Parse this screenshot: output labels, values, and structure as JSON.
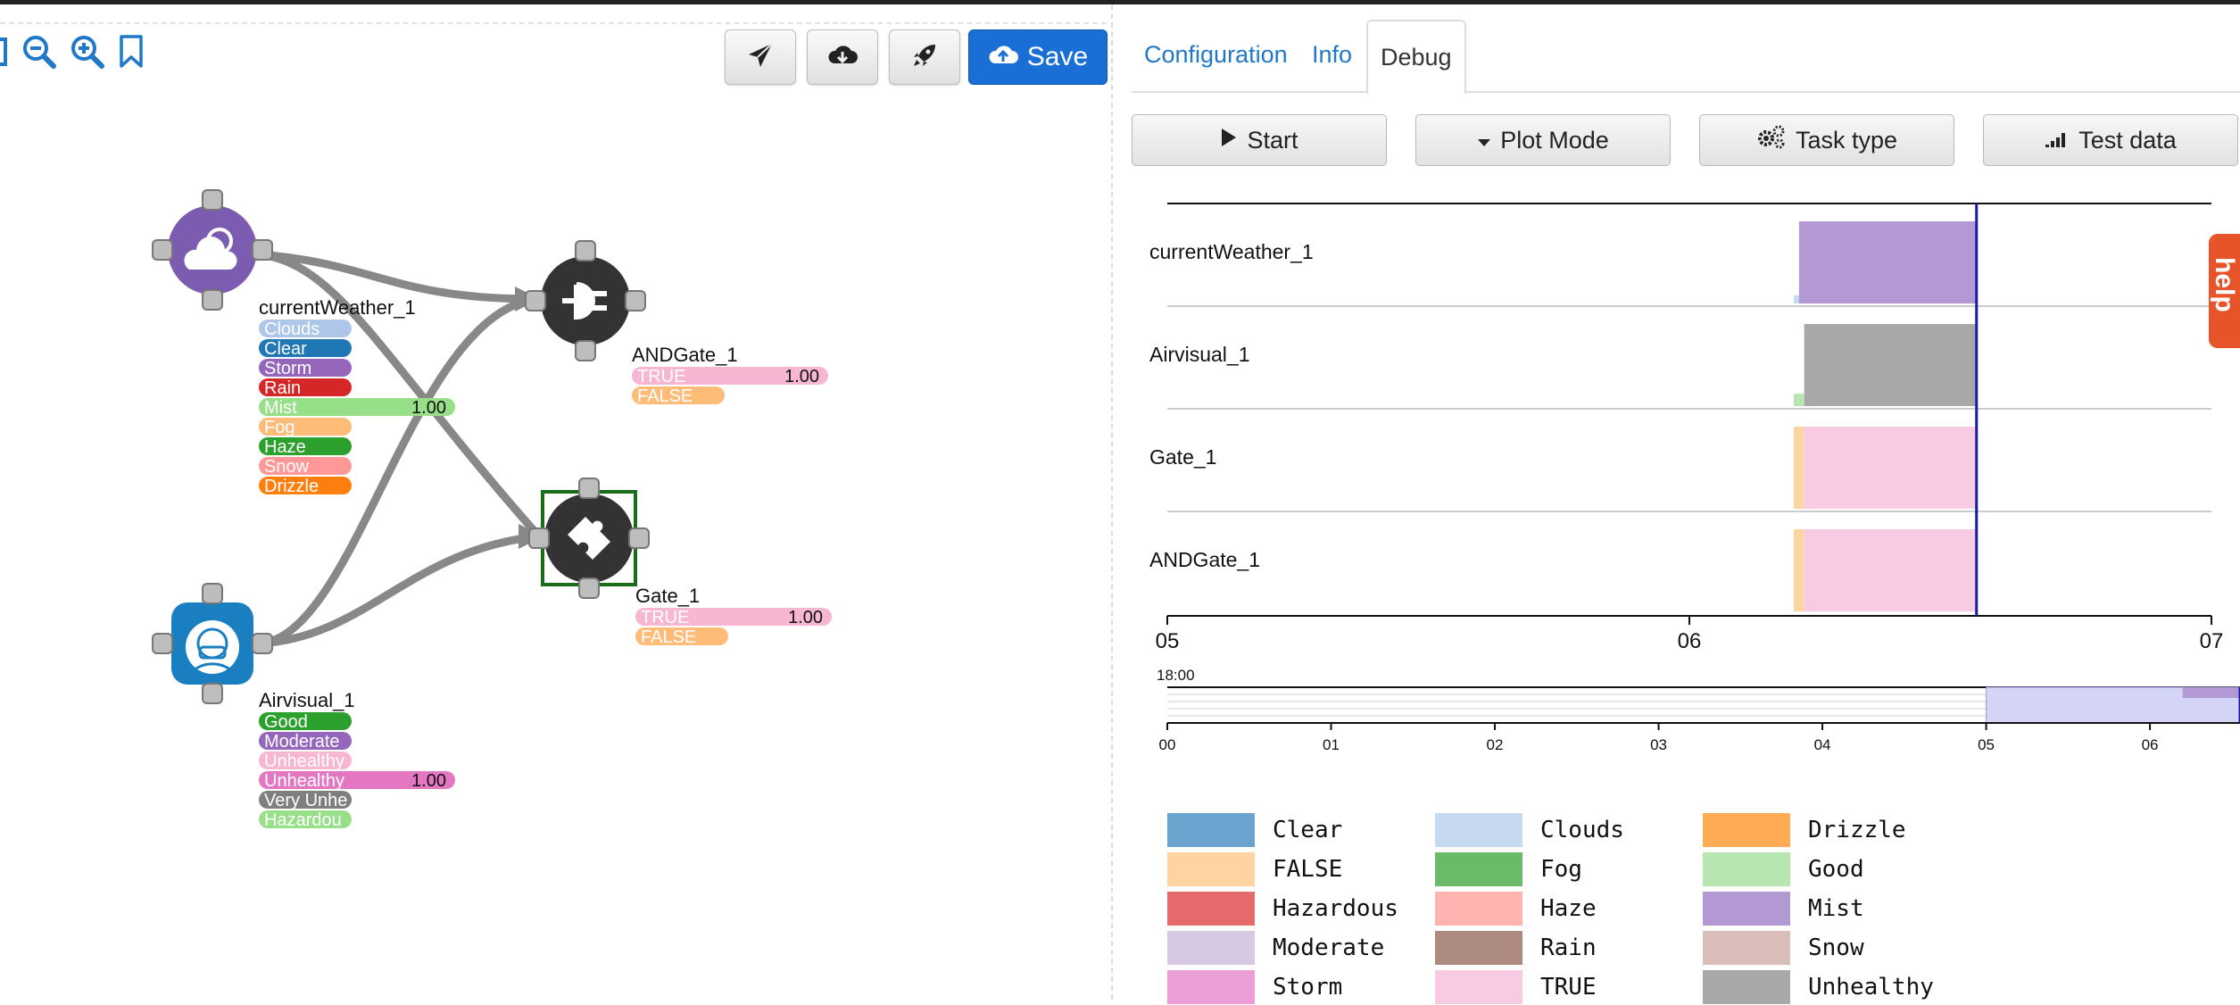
{
  "toolbar": {
    "zoom_icons": [
      "zoom-out-icon",
      "zoom-in-icon",
      "bookmark-icon"
    ],
    "buttons": [
      {
        "icon": "send-icon"
      },
      {
        "icon": "download-icon"
      },
      {
        "icon": "rocket-icon"
      }
    ],
    "save_label": "Save"
  },
  "graph": {
    "nodes": [
      {
        "id": "currentWeather_1",
        "label": "currentWeather_1",
        "icon": "weather-icon",
        "color": "#7b5cb0",
        "outputs": [
          {
            "label": "Clouds",
            "color": "#aec7e8",
            "value": null
          },
          {
            "label": "Clear",
            "color": "#1f77b4",
            "value": null
          },
          {
            "label": "Storm",
            "color": "#9467bd",
            "value": null
          },
          {
            "label": "Rain",
            "color": "#d62728",
            "value": null
          },
          {
            "label": "Mist",
            "color": "#98df8a",
            "value": "1.00"
          },
          {
            "label": "Fog",
            "color": "#ffbb78",
            "value": null
          },
          {
            "label": "Haze",
            "color": "#2ca02c",
            "value": null
          },
          {
            "label": "Snow",
            "color": "#ff9896",
            "value": null
          },
          {
            "label": "Drizzle",
            "color": "#ff7f0e",
            "value": null
          }
        ]
      },
      {
        "id": "ANDGate_1",
        "label": "ANDGate_1",
        "icon": "plug-icon",
        "color": "#333",
        "outputs": [
          {
            "label": "TRUE",
            "color": "#f7b6d2",
            "value": "1.00"
          },
          {
            "label": "FALSE",
            "color": "#ffbb78",
            "value": null
          }
        ]
      },
      {
        "id": "Gate_1",
        "label": "Gate_1",
        "icon": "puzzle-icon",
        "color": "#333",
        "outputs": [
          {
            "label": "TRUE",
            "color": "#f7b6d2",
            "value": "1.00"
          },
          {
            "label": "FALSE",
            "color": "#ffbb78",
            "value": null
          }
        ]
      },
      {
        "id": "Airvisual_1",
        "label": "Airvisual_1",
        "icon": "mask-face-icon",
        "color": "#1a7fc1",
        "outputs": [
          {
            "label": "Good",
            "color": "#2ca02c",
            "value": null
          },
          {
            "label": "Moderate",
            "color": "#9467bd",
            "value": null
          },
          {
            "label": "Unhealthy",
            "color": "#f7b6d2",
            "value": null
          },
          {
            "label": "Unhealthy",
            "color": "#e377c2",
            "value": "1.00"
          },
          {
            "label": "Very Unhe",
            "color": "#7f7f7f",
            "value": null
          },
          {
            "label": "Hazardou",
            "color": "#98df8a",
            "value": null
          }
        ]
      }
    ]
  },
  "panel": {
    "tabs": [
      {
        "label": "Configuration",
        "active": false
      },
      {
        "label": "Info",
        "active": false
      },
      {
        "label": "Debug",
        "active": true
      }
    ],
    "buttons": [
      {
        "label": "Start",
        "icon": "play-icon"
      },
      {
        "label": "Plot Mode",
        "icon": "caret-down-icon"
      },
      {
        "label": "Task type",
        "icon": "gears-icon"
      },
      {
        "label": "Test data",
        "icon": "signal-icon"
      }
    ],
    "help_label": "help"
  },
  "chart_data": {
    "type": "timeline",
    "rows": [
      "currentWeather_1",
      "Airvisual_1",
      "Gate_1",
      "ANDGate_1"
    ],
    "main_axis": {
      "ticks": [
        "05",
        "06",
        "07"
      ],
      "range_hours": [
        5,
        7
      ]
    },
    "cursor_hour": 6.55,
    "segments": [
      {
        "row": "currentWeather_1",
        "state": "Clouds",
        "start": 6.2,
        "end": 6.22,
        "level": 0.1
      },
      {
        "row": "currentWeather_1",
        "state": "Mist",
        "start": 6.21,
        "end": 6.55,
        "level": 1.0
      },
      {
        "row": "Airvisual_1",
        "state": "Good",
        "start": 6.2,
        "end": 6.22,
        "level": 0.15
      },
      {
        "row": "Airvisual_1",
        "state": "Unhealthy",
        "start": 6.22,
        "end": 6.55,
        "level": 1.0
      },
      {
        "row": "Gate_1",
        "state": "FALSE",
        "start": 6.2,
        "end": 6.22,
        "level": 1.0
      },
      {
        "row": "Gate_1",
        "state": "TRUE",
        "start": 6.22,
        "end": 6.55,
        "level": 1.0
      },
      {
        "row": "ANDGate_1",
        "state": "FALSE",
        "start": 6.2,
        "end": 6.22,
        "level": 1.0
      },
      {
        "row": "ANDGate_1",
        "state": "TRUE",
        "start": 6.22,
        "end": 6.55,
        "level": 1.0
      }
    ],
    "overview": {
      "date_label": "18:00",
      "ticks": [
        "00",
        "01",
        "02",
        "03",
        "04",
        "05",
        "06"
      ],
      "range_hours": [
        0,
        6.55
      ],
      "brush": [
        5,
        6.55
      ]
    },
    "legend": [
      {
        "label": "Clear",
        "color": "#6ba3cf"
      },
      {
        "label": "Clouds",
        "color": "#c6d9f0"
      },
      {
        "label": "Drizzle",
        "color": "#ffaa55"
      },
      {
        "label": "FALSE",
        "color": "#ffd4a3"
      },
      {
        "label": "Fog",
        "color": "#6aba6a"
      },
      {
        "label": "Good",
        "color": "#b8e6b0"
      },
      {
        "label": "Hazardous",
        "color": "#e46a6c"
      },
      {
        "label": "Haze",
        "color": "#ffb4b2"
      },
      {
        "label": "Mist",
        "color": "#b399d4"
      },
      {
        "label": "Moderate",
        "color": "#d7c8e3"
      },
      {
        "label": "Rain",
        "color": "#ad8a80"
      },
      {
        "label": "Snow",
        "color": "#d9bdb8"
      },
      {
        "label": "Storm",
        "color": "#ec9fd6"
      },
      {
        "label": "TRUE",
        "color": "#f8cbe2"
      },
      {
        "label": "Unhealthy",
        "color": "#a8a8a8"
      }
    ]
  }
}
